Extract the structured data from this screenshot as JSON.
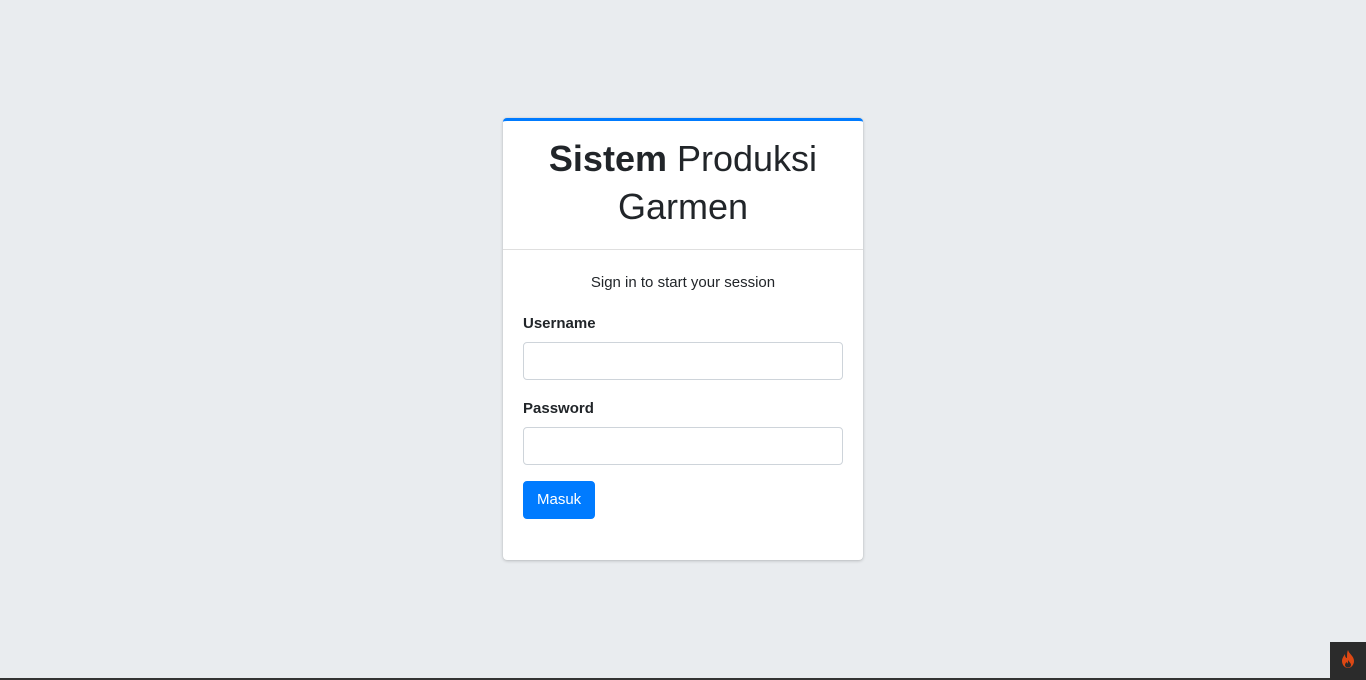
{
  "login": {
    "title_bold": "Sistem",
    "title_rest": " Produksi Garmen",
    "message": "Sign in to start your session",
    "username_label": "Username",
    "username_value": "",
    "password_label": "Password",
    "password_value": "",
    "submit_label": "Masuk"
  },
  "theme": {
    "accent": "#007bff",
    "background": "#e9ecef"
  },
  "toolbar": {
    "icon": "flame-icon"
  }
}
